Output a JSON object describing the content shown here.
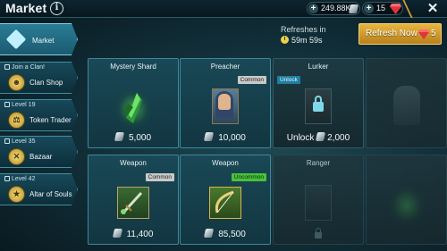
{
  "header": {
    "title": "Market",
    "silver_amount": "249.88K",
    "gem_amount": "15"
  },
  "refresh": {
    "label": "Refreshes in",
    "timer": "59m 59s",
    "button_label": "Refresh Now",
    "button_cost": "5"
  },
  "sidebar": {
    "items": [
      {
        "label": "Market",
        "lock_text": ""
      },
      {
        "label": "Clan Shop",
        "lock_text": "Join a Clan!"
      },
      {
        "label": "Token Trader",
        "lock_text": "Level 19"
      },
      {
        "label": "Bazaar",
        "lock_text": "Level 35"
      },
      {
        "label": "Altar of Souls",
        "lock_text": "Level 42"
      }
    ]
  },
  "cards": [
    {
      "name": "Mystery Shard",
      "price": "5,000",
      "tag": ""
    },
    {
      "name": "Preacher",
      "price": "10,000",
      "tag": "Common"
    },
    {
      "name": "Lurker",
      "price": "2,000",
      "tag": "Unlock",
      "price_prefix": "Unlock"
    },
    {
      "name": "Weapon",
      "price": "11,400",
      "tag": "Common"
    },
    {
      "name": "Weapon",
      "price": "85,500",
      "tag": "Uncommon"
    },
    {
      "name": "Ranger",
      "price": "",
      "tag": ""
    }
  ],
  "colors": {
    "accent": "#3b8a9c",
    "refresh_button": "#e8b53f",
    "gem": "#e0343d",
    "common_tag": "#c9c9c9",
    "uncommon_tag": "#48c23b"
  }
}
